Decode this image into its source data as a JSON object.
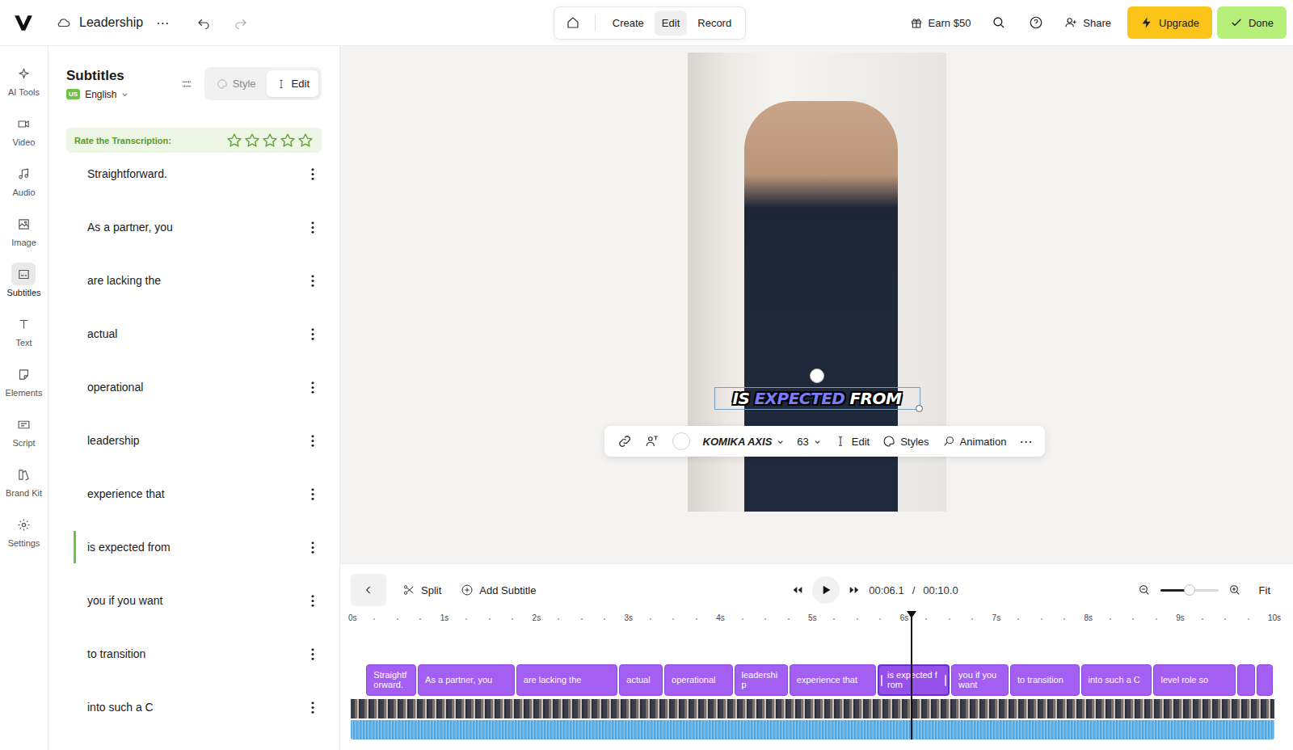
{
  "window": {
    "title": "Leadership"
  },
  "topbar": {
    "project": "Leadership",
    "more": "⋯",
    "modes": [
      {
        "label": "Create",
        "selected": false
      },
      {
        "label": "Edit",
        "selected": true
      },
      {
        "label": "Record",
        "selected": false
      }
    ],
    "earn": "Earn $50",
    "share": "Share",
    "upgrade": "Upgrade",
    "done": "Done"
  },
  "rail": [
    {
      "label": "AI Tools",
      "selected": false
    },
    {
      "label": "Video",
      "selected": false
    },
    {
      "label": "Audio",
      "selected": false
    },
    {
      "label": "Image",
      "selected": false
    },
    {
      "label": "Subtitles",
      "selected": true
    },
    {
      "label": "Text",
      "selected": false
    },
    {
      "label": "Elements",
      "selected": false
    },
    {
      "label": "Script",
      "selected": false
    },
    {
      "label": "Brand Kit",
      "selected": false
    },
    {
      "label": "Settings",
      "selected": false
    }
  ],
  "panel": {
    "title": "Subtitles",
    "flag": "US",
    "language": "English",
    "tabs": [
      {
        "label": "Style",
        "selected": false
      },
      {
        "label": "Edit",
        "selected": true
      }
    ],
    "rating": {
      "label": "Rate the Transcription:",
      "stars": 0,
      "max": 5
    },
    "items": [
      {
        "text": "Straightforward.",
        "selected": false
      },
      {
        "text": "As a partner, you",
        "selected": false
      },
      {
        "text": "are lacking the",
        "selected": false
      },
      {
        "text": "actual",
        "selected": false
      },
      {
        "text": "operational",
        "selected": false
      },
      {
        "text": "leadership",
        "selected": false
      },
      {
        "text": "experience that",
        "selected": false
      },
      {
        "text": "is expected from",
        "selected": true
      },
      {
        "text": "you if you want",
        "selected": false
      },
      {
        "text": "to transition",
        "selected": false
      },
      {
        "text": "into such a C",
        "selected": false
      }
    ]
  },
  "preview": {
    "caption": [
      {
        "word": "IS",
        "highlighted": false
      },
      {
        "word": "EXPECTED",
        "highlighted": true
      },
      {
        "word": "FROM",
        "highlighted": false
      }
    ],
    "toolbar": {
      "font": "KOMIKA AXIS",
      "size": "63",
      "edit": "Edit",
      "styles": "Styles",
      "animation": "Animation",
      "more": "⋯"
    }
  },
  "timeline": {
    "split": "Split",
    "add": "Add Subtitle",
    "current": "00:06.1",
    "separator": "/",
    "total": "00:10.0",
    "fit": "Fit",
    "zoom": {
      "level": 0.5
    },
    "duration": 10,
    "playhead": 6.1,
    "ruler": [
      "0s",
      "1s",
      "2s",
      "3s",
      "4s",
      "5s",
      "6s",
      "7s",
      "8s",
      "9s",
      "10s"
    ],
    "clips": [
      {
        "text": "Straightforward.",
        "start": 0.17,
        "end": 0.73,
        "selected": false
      },
      {
        "text": "As a partner, you",
        "start": 0.73,
        "end": 1.8,
        "selected": false
      },
      {
        "text": "are lacking the",
        "start": 1.8,
        "end": 2.92,
        "selected": false
      },
      {
        "text": "actual",
        "start": 2.92,
        "end": 3.41,
        "selected": false
      },
      {
        "text": "operational",
        "start": 3.41,
        "end": 4.17,
        "selected": false
      },
      {
        "text": "leadership",
        "start": 4.17,
        "end": 4.77,
        "selected": false
      },
      {
        "text": "experience that",
        "start": 4.77,
        "end": 5.73,
        "selected": false
      },
      {
        "text": "is expected from",
        "start": 5.73,
        "end": 6.53,
        "selected": true
      },
      {
        "text": "you if you want",
        "start": 6.53,
        "end": 7.17,
        "selected": false
      },
      {
        "text": "to transition",
        "start": 7.17,
        "end": 7.94,
        "selected": false
      },
      {
        "text": "into such a C",
        "start": 7.94,
        "end": 8.73,
        "selected": false
      },
      {
        "text": "level role so",
        "start": 8.73,
        "end": 9.64,
        "selected": false
      },
      {
        "text": "",
        "start": 9.64,
        "end": 9.85,
        "selected": false
      },
      {
        "text": "",
        "start": 9.85,
        "end": 10.04,
        "selected": false
      }
    ]
  }
}
